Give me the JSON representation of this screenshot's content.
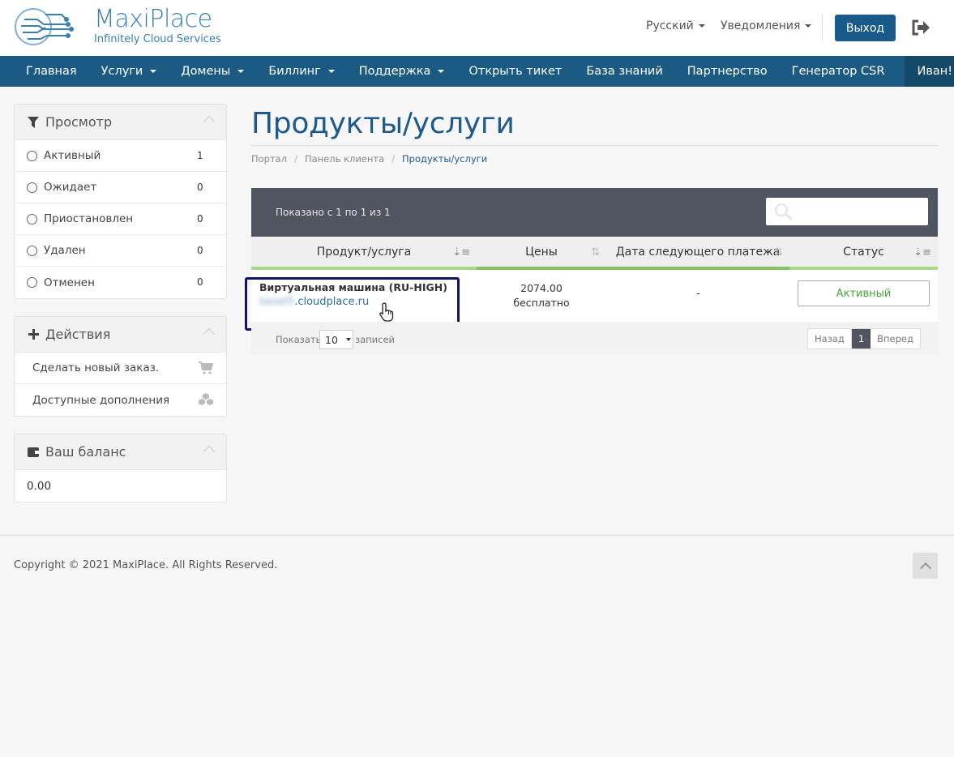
{
  "brand": {
    "name": "MaxiPlace",
    "tagline": "Infinitely Cloud Services",
    "accent": "#1b5a82"
  },
  "header": {
    "language": "Русский",
    "notifications": "Уведомления",
    "logout_label": "Выход",
    "logout_icon": "sign-out-icon"
  },
  "nav": {
    "items": [
      {
        "label": "Главная",
        "dropdown": false
      },
      {
        "label": "Услуги",
        "dropdown": true
      },
      {
        "label": "Домены",
        "dropdown": true
      },
      {
        "label": "Биллинг",
        "dropdown": true
      },
      {
        "label": "Поддержка",
        "dropdown": true
      },
      {
        "label": "Открыть тикет",
        "dropdown": false
      },
      {
        "label": "База знаний",
        "dropdown": false
      },
      {
        "label": "Партнерство",
        "dropdown": false
      },
      {
        "label": "Генератор CSR",
        "dropdown": false
      }
    ],
    "user": "Иван!"
  },
  "sidebar": {
    "view": {
      "title": "Просмотр",
      "icon": "filter-icon",
      "filters": [
        {
          "label": "Активный",
          "count": "1"
        },
        {
          "label": "Ожидает",
          "count": "0"
        },
        {
          "label": "Приостановлен",
          "count": "0"
        },
        {
          "label": "Удален",
          "count": "0"
        },
        {
          "label": "Отменен",
          "count": "0"
        }
      ]
    },
    "actions": {
      "title": "Действия",
      "icon": "plus-icon",
      "items": [
        {
          "label": "Сделать новый заказ.",
          "icon": "cart-icon"
        },
        {
          "label": "Доступные дополнения",
          "icon": "cubes-icon"
        }
      ]
    },
    "balance": {
      "title": "Ваш баланс",
      "icon": "wallet-icon",
      "value": "0.00"
    }
  },
  "main": {
    "title": "Продукты/услуги",
    "breadcrumb": [
      "Портал",
      "Панель клиента",
      "Продукты/услуги"
    ],
    "table": {
      "showing": "Показано с 1 по 1 из 1",
      "search_placeholder": "",
      "columns": [
        "Продукт/услуга",
        "Цены",
        "Дата следующего платежа",
        "Статус"
      ],
      "rows": [
        {
          "product": "Виртуальная машина (RU-HIGH)",
          "domain_blurred": "bexel5",
          "domain_suffix": ".cloudplace.ru",
          "price": "2074.00",
          "billing": "бесплатно",
          "next_date": "-",
          "status": "Активный"
        }
      ],
      "show_label": "Показать",
      "per_page": "10",
      "records_label": "записей",
      "pager": {
        "prev": "Назад",
        "current": "1",
        "next": "Вперед"
      }
    }
  },
  "footer": {
    "copyright": "Copyright © 2021 MaxiPlace. All Rights Reserved."
  }
}
